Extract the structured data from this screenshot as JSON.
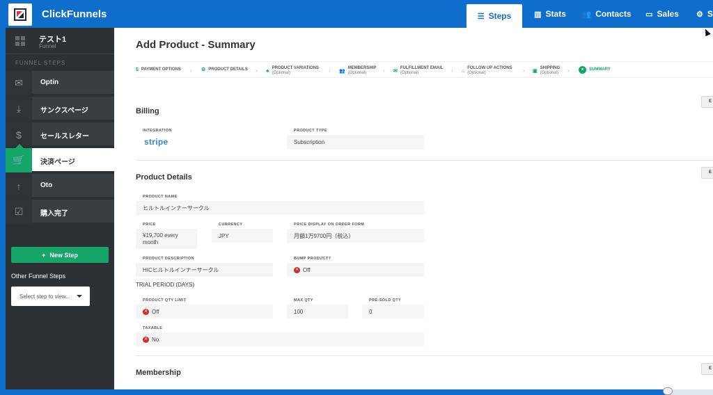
{
  "app": {
    "brand": "ClickFunnels"
  },
  "topnav": [
    {
      "label": "Steps",
      "icon": "list-icon",
      "active": true
    },
    {
      "label": "Stats",
      "icon": "bar-chart-icon"
    },
    {
      "label": "Contacts",
      "icon": "users-icon"
    },
    {
      "label": "Sales",
      "icon": "money-icon"
    },
    {
      "label": "S",
      "icon": "gear-icon"
    }
  ],
  "sidebar": {
    "funnel_name": "テスト1",
    "funnel_sub": "Funnel",
    "section_title": "FUNNEL STEPS",
    "steps": [
      {
        "label": "Optin",
        "icon": "envelope-icon"
      },
      {
        "label": "サンクスページ",
        "icon": "download-icon"
      },
      {
        "label": "セールスレター",
        "icon": "dollar-icon"
      },
      {
        "label": "決済ページ",
        "icon": "cart-icon",
        "active": true
      },
      {
        "label": "Oto",
        "icon": "arrow-up-icon"
      },
      {
        "label": "購入完了",
        "icon": "check-icon"
      }
    ],
    "new_step": "New Step",
    "other_label": "Other Funnel Steps",
    "select_placeholder": "Select step to view..."
  },
  "page": {
    "title": "Add Product - Summary",
    "wizard": [
      {
        "label": "PAYMENT OPTIONS",
        "sub": ""
      },
      {
        "label": "PRODUCT DETAILS",
        "sub": ""
      },
      {
        "label": "PRODUCT VARIATIONS",
        "sub": "(Optional)"
      },
      {
        "label": "MEMBERSHIP",
        "sub": "(Optional)"
      },
      {
        "label": "FULFILLMENT EMAIL",
        "sub": "(Optional)"
      },
      {
        "label": "FOLLOW UP ACTIONS",
        "sub": "(Optional)"
      },
      {
        "label": "SHIPPING",
        "sub": "(Optional)"
      },
      {
        "label": "SUMMARY",
        "sub": ""
      }
    ],
    "edit_label": "E",
    "billing": {
      "title": "Billing",
      "integration_label": "INTEGRATION",
      "integration_value": "stripe",
      "product_type_label": "PRODUCT TYPE",
      "product_type_value": "Subscription"
    },
    "product_details": {
      "title": "Product Details",
      "name_label": "PRODUCT NAME",
      "name_value": "ヒルトルインナーサークル",
      "price_label": "PRICE",
      "price_value": "¥19,700 every month",
      "currency_label": "CURRENCY",
      "currency_value": "JPY",
      "price_display_label": "PRICE DISPLAY ON ORDER FORM",
      "price_display_value": "月額1万9700円（税込）",
      "description_label": "PRODUCT DESCRIPTION",
      "description_value": "HICヒルトルインナーサークル",
      "bump_label": "BUMP PRODUCT?",
      "bump_value": "Off",
      "trial_label": "TRIAL PERIOD (DAYS)",
      "qty_limit_label": "PRODUCT QTY LIMIT",
      "qty_limit_value": "Off",
      "max_qty_label": "MAX QTY",
      "max_qty_value": "100",
      "presold_label": "PRE-SOLD QTY",
      "presold_value": "0",
      "taxable_label": "TAXABLE",
      "taxable_value": "No"
    },
    "membership": {
      "title": "Membership"
    }
  }
}
